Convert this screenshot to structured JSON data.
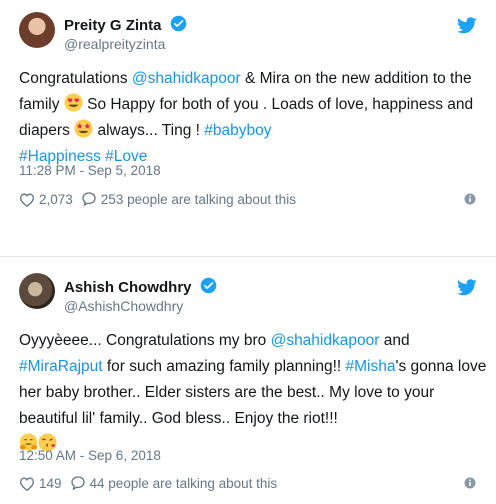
{
  "colors": {
    "link": "#1b95e0",
    "verified": "#1da1f2",
    "muted": "#657786",
    "heart": "#657786"
  },
  "tweets": [
    {
      "name": "Preity G Zinta",
      "handle": "@realpreityzinta",
      "text_parts": {
        "p1": "Congratulations ",
        "m1": "@shahidkapoor",
        "p2": " & Mira on the new addition to the family ",
        "p3": " So Happy for both of you . Loads of love, happiness and diapers ",
        "p4": " always... Ting ! ",
        "h1": "#babyboy",
        "h2": "#Happiness",
        "h3": "#Love"
      },
      "timestamp": "11:28 PM - Sep 5, 2018",
      "likes": "2,073",
      "talking": "253 people are talking about this",
      "emojis": [
        "heart-eyes",
        "star-struck"
      ]
    },
    {
      "name": "Ashish Chowdhry",
      "handle": "@AshishChowdhry",
      "text_parts": {
        "p1": "Oyyyèeee... Congratulations my bro ",
        "m1": "@shahidkapoor",
        "p2": " and ",
        "m2": "#MiraRajput",
        "p3": " for such amazing family planning!! ",
        "h1": "#Misha",
        "p4": "'s gonna love her baby brother.. Elder sisters are the best.. My love to your beautiful lil' family.. God bless.. Enjoy the riot!!!"
      },
      "timestamp": "12:50 AM - Sep 6, 2018",
      "likes": "149",
      "talking": "44 people are talking about this",
      "emojis": [
        "hugging",
        "kissing"
      ]
    }
  ]
}
